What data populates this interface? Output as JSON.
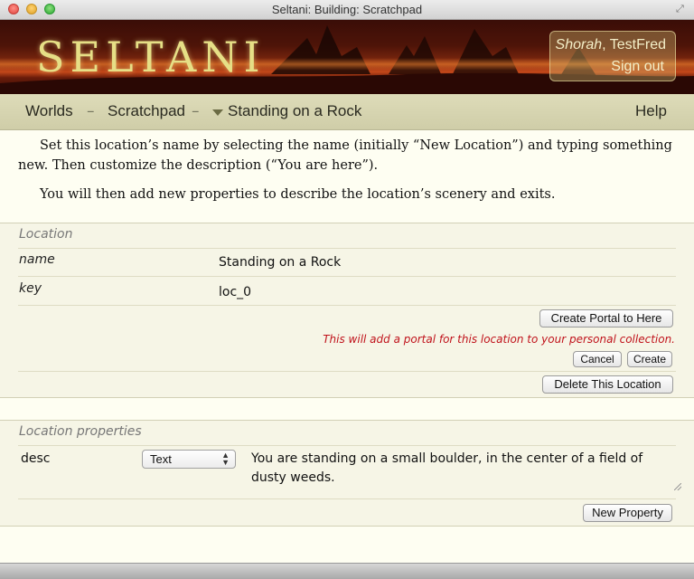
{
  "window": {
    "title": "Seltani: Building: Scratchpad"
  },
  "banner": {
    "logo": "SELTANI",
    "user_name": "Shorah",
    "user_sep": ", ",
    "user_account": "TestFred",
    "signout": "Sign out"
  },
  "nav": {
    "worlds": "Worlds",
    "sep": "–",
    "scratchpad": "Scratchpad",
    "current": "Standing on a Rock",
    "help": "Help"
  },
  "intro": {
    "p1": "Set this location’s name by selecting the name (initially “New Location”) and typing something new. Then customize the description (“You are here”).",
    "p2": "You will then add new properties to describe the location’s scenery and exits."
  },
  "location": {
    "heading": "Location",
    "name_label": "name",
    "name_value": "Standing on a Rock",
    "key_label": "key",
    "key_value": "loc_0",
    "create_portal_button": "Create Portal to Here",
    "portal_note": "This will add a portal for this location to your personal collection.",
    "cancel_button": "Cancel",
    "create_button": "Create",
    "delete_button": "Delete This Location"
  },
  "properties": {
    "heading": "Location properties",
    "rows": [
      {
        "key": "desc",
        "type": "Text",
        "value": "You are standing on a small boulder, in the center of a field of dusty weeds."
      }
    ],
    "new_property_button": "New Property"
  },
  "colors": {
    "banner": "#4e1408",
    "logo": "#e6df86",
    "nav_bg": "#d6d4b0",
    "page_bg": "#fefef2",
    "note": "#c0121b"
  }
}
